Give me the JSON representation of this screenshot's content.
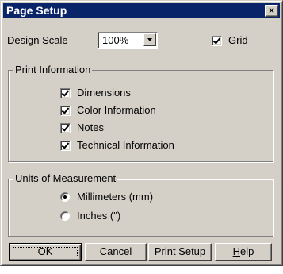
{
  "window": {
    "title": "Page Setup",
    "close_glyph": "×"
  },
  "design_scale": {
    "label": "Design Scale",
    "value": "100%"
  },
  "grid": {
    "label": "Grid",
    "checked": true
  },
  "print_information": {
    "title": "Print Information",
    "items": [
      {
        "label": "Dimensions",
        "checked": true
      },
      {
        "label": "Color Information",
        "checked": true
      },
      {
        "label": "Notes",
        "checked": true
      },
      {
        "label": "Technical Information",
        "checked": true
      }
    ]
  },
  "units": {
    "title": "Units of Measurement",
    "options": [
      {
        "label": "Millimeters (mm)",
        "selected": true
      },
      {
        "label": "Inches (\")",
        "selected": false
      }
    ]
  },
  "buttons": {
    "ok": "OK",
    "cancel": "Cancel",
    "print_setup": "Print Setup",
    "help_first": "H",
    "help_rest": "elp"
  }
}
